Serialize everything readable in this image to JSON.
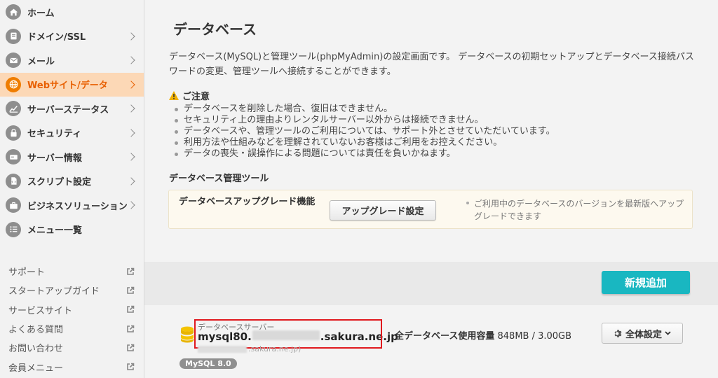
{
  "sidebar": {
    "items": [
      {
        "label": "ホーム",
        "icon": "home-icon",
        "has_chevron": false
      },
      {
        "label": "ドメイン/SSL",
        "icon": "domain-icon",
        "has_chevron": true
      },
      {
        "label": "メール",
        "icon": "mail-icon",
        "has_chevron": true
      },
      {
        "label": "Webサイト/データ",
        "icon": "globe-icon",
        "has_chevron": true,
        "active": true
      },
      {
        "label": "サーバーステータス",
        "icon": "chart-icon",
        "has_chevron": true
      },
      {
        "label": "セキュリティ",
        "icon": "lock-icon",
        "has_chevron": true
      },
      {
        "label": "サーバー情報",
        "icon": "server-icon",
        "has_chevron": true
      },
      {
        "label": "スクリプト設定",
        "icon": "script-icon",
        "has_chevron": true
      },
      {
        "label": "ビジネスソリューション",
        "icon": "briefcase-icon",
        "has_chevron": true
      },
      {
        "label": "メニュー一覧",
        "icon": "list-icon",
        "has_chevron": false
      }
    ],
    "links": [
      {
        "label": "サポート"
      },
      {
        "label": "スタートアップガイド"
      },
      {
        "label": "サービスサイト"
      },
      {
        "label": "よくある質問"
      },
      {
        "label": "お問い合わせ"
      },
      {
        "label": "会員メニュー"
      }
    ],
    "active_color": "#e85f00",
    "active_bg": "#fcd8b6"
  },
  "main": {
    "title": "データベース",
    "description": "データベース(MySQL)と管理ツール(phpMyAdmin)の設定画面です。 データベースの初期セットアップとデータベース接続パスワードの変更、管理ツールへ接続することができます。",
    "caution": {
      "title": "ご注意",
      "items": [
        "データベースを削除した場合、復旧はできません。",
        "セキュリティ上の理由よりレンタルサーバー以外からは接続できません。",
        "データベースや、管理ツールのご利用については、サポート外とさせていただいています。",
        "利用方法や仕組みなどを理解されていないお客様はご利用をお控えください。",
        "データの喪失・誤操作による問題については責任を負いかねます。"
      ]
    },
    "tools_heading": "データベース管理ツール",
    "tool": {
      "name": "データベースアップグレード機能",
      "button": "アップグレード設定",
      "note": "ご利用中のデータベースのバージョンを最新版へアップグレードできます"
    },
    "add_button": "新規追加",
    "add_button_color": "#19b7c1",
    "db": {
      "caption": "データベースサーバー",
      "host_prefix": "mysql80.",
      "host_suffix": ".sakura.ne.jp",
      "sub_suffix": ".sakura.ne.jp)",
      "badge": "MySQL 8.0",
      "usage_label": "全データベース使用容量",
      "usage_value": "848MB / 3.00GB",
      "settings_button": "全体設定"
    }
  }
}
